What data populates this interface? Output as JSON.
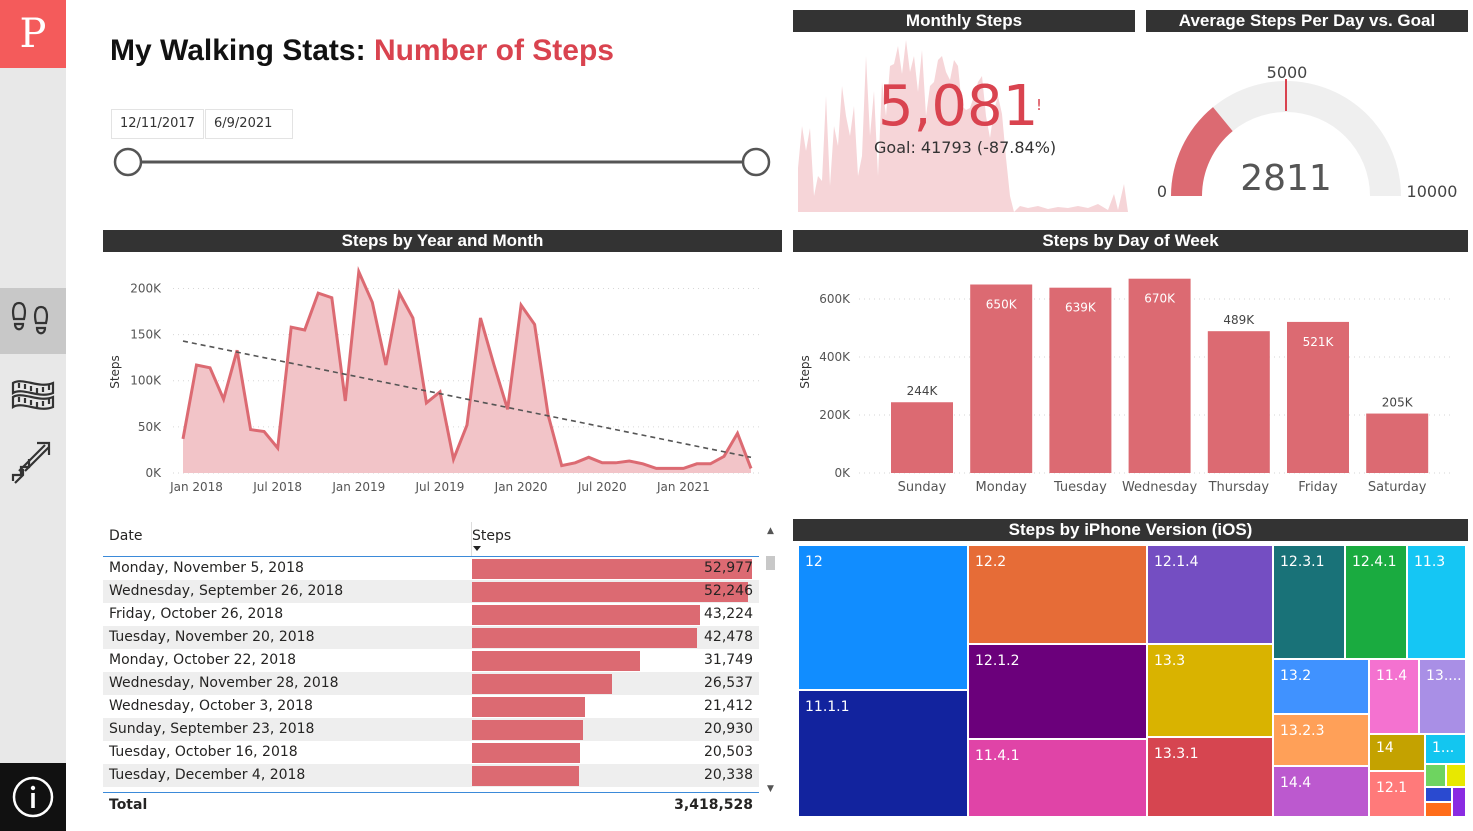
{
  "nav": {
    "logo_letter": "P",
    "items": [
      {
        "name": "steps",
        "icon": "footprints-icon",
        "active": true
      },
      {
        "name": "distance",
        "icon": "measuring-tape-icon",
        "active": false
      },
      {
        "name": "flights",
        "icon": "stairs-arrow-icon",
        "active": false
      }
    ],
    "info_icon": "info-icon"
  },
  "header": {
    "title_main": "My Walking Stats:",
    "title_accent": "Number of Steps",
    "accent_color": "#d9434f"
  },
  "date_filter": {
    "start": "12/11/2017",
    "end": "6/9/2021",
    "start_fraction": 0,
    "end_fraction": 1
  },
  "monthly_steps": {
    "title": "Monthly Steps",
    "value": "5,081",
    "indicator": "!",
    "goal_text": "Goal: 41793 (-87.84%)"
  },
  "gauge": {
    "title": "Average Steps Per Day vs. Goal",
    "value": 2811,
    "value_label": "2811",
    "goal": 5000,
    "goal_label": "5000",
    "min": 0,
    "min_label": "0",
    "max": 10000,
    "max_label": "10000",
    "fill_color": "#dc6a72",
    "track_color": "#efefef"
  },
  "chart_data": [
    {
      "type": "area",
      "title": "Steps by Year and Month",
      "xlabel": "",
      "ylabel": "Steps",
      "ylim": [
        0,
        220000
      ],
      "y_ticks": [
        "0K",
        "50K",
        "100K",
        "150K",
        "200K"
      ],
      "y_tick_values": [
        0,
        50000,
        100000,
        150000,
        200000
      ],
      "x_tick_labels": [
        "Jan 2018",
        "Jul 2018",
        "Jan 2019",
        "Jul 2019",
        "Jan 2020",
        "Jul 2020",
        "Jan 2021"
      ],
      "x_tick_index": [
        1,
        7,
        13,
        19,
        25,
        31,
        37
      ],
      "series": [
        {
          "values": [
            37000,
            117000,
            114000,
            80000,
            133000,
            47000,
            45000,
            27000,
            158000,
            155000,
            195000,
            190000,
            78000,
            218000,
            185000,
            117000,
            195000,
            168000,
            76000,
            88000,
            15000,
            52000,
            168000,
            117000,
            69000,
            182000,
            161000,
            63000,
            8000,
            11000,
            17000,
            11000,
            11000,
            13000,
            10000,
            5000,
            5000,
            5000,
            10000,
            10000,
            18000,
            43000,
            5000
          ]
        }
      ],
      "trendline": {
        "style": "dashed",
        "start": 143000,
        "end": 17000
      },
      "grid": true
    },
    {
      "type": "bar",
      "title": "Steps by Day of Week",
      "xlabel": "",
      "ylabel": "Steps",
      "ylim": [
        0,
        700000
      ],
      "y_ticks": [
        "0K",
        "200K",
        "400K",
        "600K"
      ],
      "y_tick_values": [
        0,
        200000,
        400000,
        600000
      ],
      "categories": [
        "Sunday",
        "Monday",
        "Tuesday",
        "Wednesday",
        "Thursday",
        "Friday",
        "Saturday"
      ],
      "values": [
        244000,
        650000,
        639000,
        670000,
        489000,
        521000,
        205000
      ],
      "data_labels": [
        "244K",
        "650K",
        "639K",
        "670K",
        "489K",
        "521K",
        "205K"
      ],
      "color": "#dc6a72",
      "grid": true
    },
    {
      "type": "table",
      "columns": [
        "Date",
        "Steps"
      ],
      "sorted_by": "Steps",
      "rows": [
        {
          "date": "Monday, November 5, 2018",
          "steps": "52,977",
          "value": 52977
        },
        {
          "date": "Wednesday, September 26, 2018",
          "steps": "52,246",
          "value": 52246
        },
        {
          "date": "Friday, October 26, 2018",
          "steps": "43,224",
          "value": 43224
        },
        {
          "date": "Tuesday, November 20, 2018",
          "steps": "42,478",
          "value": 42478
        },
        {
          "date": "Monday, October 22, 2018",
          "steps": "31,749",
          "value": 31749
        },
        {
          "date": "Wednesday, November 28, 2018",
          "steps": "26,537",
          "value": 26537
        },
        {
          "date": "Wednesday, October 3, 2018",
          "steps": "21,412",
          "value": 21412
        },
        {
          "date": "Sunday, September 23, 2018",
          "steps": "20,930",
          "value": 20930
        },
        {
          "date": "Tuesday, October 16, 2018",
          "steps": "20,503",
          "value": 20503
        },
        {
          "date": "Tuesday, December 4, 2018",
          "steps": "20,338",
          "value": 20338
        }
      ],
      "total_label": "Total",
      "total_value": "3,418,528",
      "bar_color": "#dc6a72"
    },
    {
      "type": "treemap",
      "title": "Steps by iPhone Version (iOS)",
      "tiles": [
        {
          "label": "12",
          "color": "#118dff"
        },
        {
          "label": "11.1.1",
          "color": "#12239e"
        },
        {
          "label": "12.2",
          "color": "#e66c37"
        },
        {
          "label": "12.1.2",
          "color": "#6b007b"
        },
        {
          "label": "11.4.1",
          "color": "#e044a7"
        },
        {
          "label": "12.1.4",
          "color": "#744ec2"
        },
        {
          "label": "13.3",
          "color": "#d9b300"
        },
        {
          "label": "13.3.1",
          "color": "#d64550"
        },
        {
          "label": "12.3.1",
          "color": "#197278"
        },
        {
          "label": "12.4.1",
          "color": "#1aab40"
        },
        {
          "label": "11.3",
          "color": "#15c6f4"
        },
        {
          "label": "13.2",
          "color": "#4092ff"
        },
        {
          "label": "11.4",
          "color": "#f472d0"
        },
        {
          "label": "13....",
          "color": "#a98fe6"
        },
        {
          "label": "13.2.3",
          "color": "#ffa058"
        },
        {
          "label": "14",
          "color": "#c4a200"
        },
        {
          "label": "1...",
          "color": "#13c6f0"
        },
        {
          "label": "14.4",
          "color": "#bc59cf"
        },
        {
          "label": "12.1",
          "color": "#ff7a7a"
        },
        {
          "label": "",
          "color": "#6ed460"
        },
        {
          "label": "",
          "color": "#e8e800"
        },
        {
          "label": "",
          "color": "#2a4ad0"
        },
        {
          "label": "",
          "color": "#ff6d1a"
        },
        {
          "label": "",
          "color": "#8a2be2"
        }
      ]
    }
  ]
}
